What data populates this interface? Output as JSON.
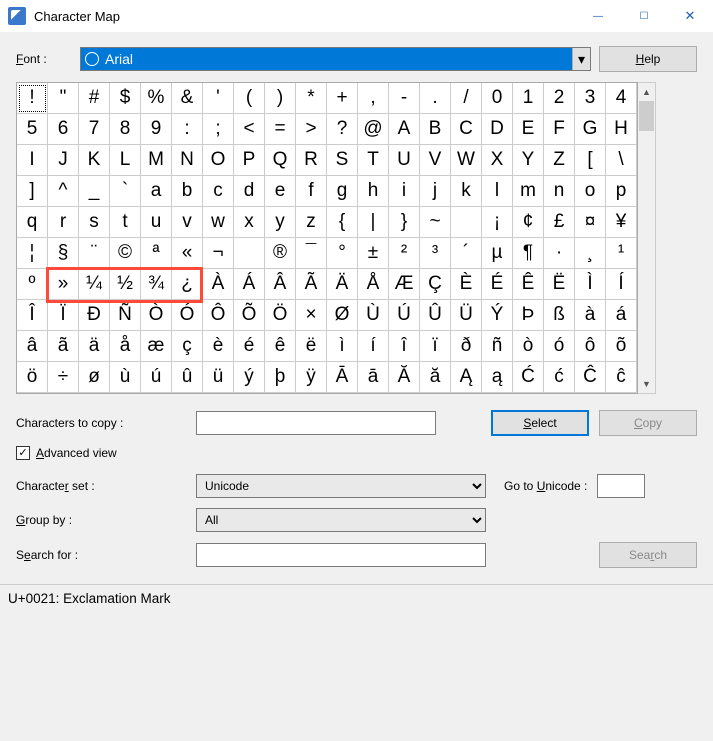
{
  "window": {
    "title": "Character Map",
    "minimize": "—",
    "maximize": "☐",
    "close": "✕"
  },
  "labels": {
    "font": "Font :",
    "font_u": "F",
    "help": "Help",
    "help_u": "H",
    "chars_to_copy": "Characters to copy :",
    "select": "Select",
    "select_u": "S",
    "copy": "Copy",
    "copy_u": "C",
    "advanced_view": "Advanced view",
    "advanced_u": "A",
    "character_set": "Character set :",
    "charset_u": "r",
    "group_by": "Group by :",
    "group_u": "G",
    "search_for": "Search for :",
    "searchfor_u": "e",
    "search": "Search",
    "search_u": "r",
    "goto_unicode": "Go to Unicode :",
    "goto_u": "U"
  },
  "font_selected": "Arial",
  "chars_value": "",
  "charset_value": "Unicode",
  "group_value": "All",
  "search_value": "",
  "goto_value": "",
  "status_text": "U+0021: Exclamation Mark",
  "grid_rows": [
    [
      "!",
      "\"",
      "#",
      "$",
      "%",
      "&",
      "'",
      "(",
      ")",
      "*",
      "+",
      ",",
      "-",
      ".",
      "/",
      "0",
      "1",
      "2",
      "3",
      "4"
    ],
    [
      "5",
      "6",
      "7",
      "8",
      "9",
      ":",
      ";",
      "<",
      "=",
      ">",
      "?",
      "@",
      "A",
      "B",
      "C",
      "D",
      "E",
      "F",
      "G",
      "H"
    ],
    [
      "I",
      "J",
      "K",
      "L",
      "M",
      "N",
      "O",
      "P",
      "Q",
      "R",
      "S",
      "T",
      "U",
      "V",
      "W",
      "X",
      "Y",
      "Z",
      "[",
      "\\"
    ],
    [
      "]",
      "^",
      "_",
      "`",
      "a",
      "b",
      "c",
      "d",
      "e",
      "f",
      "g",
      "h",
      "i",
      "j",
      "k",
      "l",
      "m",
      "n",
      "o",
      "p"
    ],
    [
      "q",
      "r",
      "s",
      "t",
      "u",
      "v",
      "w",
      "x",
      "y",
      "z",
      "{",
      "|",
      "}",
      "~",
      " ",
      "¡",
      "¢",
      "£",
      "¤",
      "¥"
    ],
    [
      "¦",
      "§",
      "¨",
      "©",
      "ª",
      "«",
      "¬",
      "­",
      "®",
      "¯",
      "°",
      "±",
      "²",
      "³",
      "´",
      "µ",
      "¶",
      "·",
      "¸",
      "¹"
    ],
    [
      "º",
      "»",
      "¼",
      "½",
      "¾",
      "¿",
      "À",
      "Á",
      "Â",
      "Ã",
      "Ä",
      "Å",
      "Æ",
      "Ç",
      "È",
      "É",
      "Ê",
      "Ë",
      "Ì",
      "Í"
    ],
    [
      "Î",
      "Ï",
      "Ð",
      "Ñ",
      "Ò",
      "Ó",
      "Ô",
      "Õ",
      "Ö",
      "×",
      "Ø",
      "Ù",
      "Ú",
      "Û",
      "Ü",
      "Ý",
      "Þ",
      "ß",
      "à",
      "á"
    ],
    [
      "â",
      "ã",
      "ä",
      "å",
      "æ",
      "ç",
      "è",
      "é",
      "ê",
      "ë",
      "ì",
      "í",
      "î",
      "ï",
      "ð",
      "ñ",
      "ò",
      "ó",
      "ô",
      "õ"
    ],
    [
      "ö",
      "÷",
      "ø",
      "ù",
      "ú",
      "û",
      "ü",
      "ý",
      "þ",
      "ÿ",
      "Ā",
      "ā",
      "Ă",
      "ă",
      "Ą",
      "ą",
      "Ć",
      "ć",
      "Ĉ",
      "ĉ"
    ]
  ],
  "selected_cell": {
    "row": 0,
    "col": 0
  },
  "highlight_box": {
    "row": 6,
    "col_start": 1,
    "col_end": 5
  }
}
